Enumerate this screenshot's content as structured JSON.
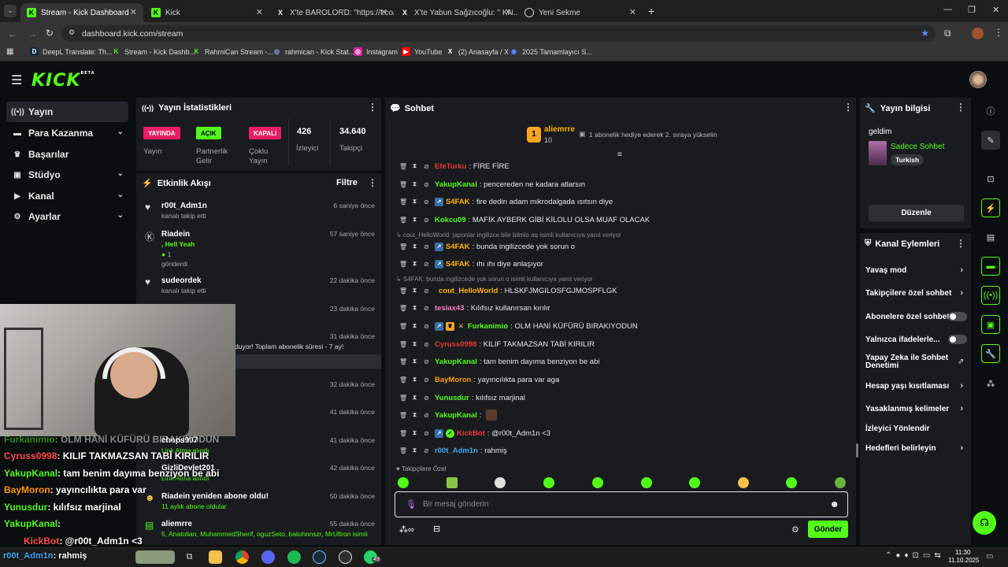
{
  "browser": {
    "tabs": [
      {
        "title": "Stream - Kick Dashboard",
        "active": true
      },
      {
        "title": "Kick",
        "active": false
      },
      {
        "title": "X'te BAROLORD: \"https://t.co/...",
        "active": false
      },
      {
        "title": "X'te Yabun Sağzıcoğlu: \" KN...",
        "active": false
      },
      {
        "title": "Yeni Sekme",
        "active": false
      }
    ],
    "url": "dashboard.kick.com/stream",
    "bookmarks": [
      "DeepL Translate: Th...",
      "Stream - Kick Dashb...",
      "RahmiCan Stream -...",
      "rahmican - Kick Stat...",
      "Instagram",
      "YouTube",
      "(2) Anasayfa / X",
      "2025 Tamamlayıcı S..."
    ]
  },
  "brand": {
    "logo": "KICK",
    "beta": "BETA",
    "accent": "#53fc18"
  },
  "sidebar": {
    "items": [
      {
        "label": "Yayın",
        "icon": "broadcast-icon",
        "active": true
      },
      {
        "label": "Para Kazanma",
        "icon": "money-icon"
      },
      {
        "label": "Başarılar",
        "icon": "trophy-icon"
      },
      {
        "label": "Stüdyo",
        "icon": "studio-icon"
      },
      {
        "label": "Kanal",
        "icon": "channel-icon"
      },
      {
        "label": "Ayarlar",
        "icon": "gear-icon"
      }
    ]
  },
  "stats": {
    "title": "Yayın İstatistikleri",
    "items": [
      {
        "badge": "YAYINDA",
        "label": "Yayın",
        "color": "#e91e63"
      },
      {
        "badge": "AÇIK",
        "label": "Partnerlik Gelir",
        "color": "#53fc18"
      },
      {
        "badge": "KAPALI",
        "label": "Çoklu Yayın",
        "color": "#e91e63"
      },
      {
        "value": "426",
        "label": "İzleyici"
      },
      {
        "value": "34.640",
        "label": "Takipçi"
      }
    ]
  },
  "activity": {
    "title": "Etkinlik Akışı",
    "filter": "Filtre",
    "items": [
      {
        "name": "r00t_Adm1n",
        "sub": "kanalı takip etti",
        "time": "6 saniye önce"
      },
      {
        "name": "Riadein",
        "sub": ", Hell Yeah",
        "extra": "1",
        "extra2": "gönderdi",
        "time": "57 saniye önce"
      },
      {
        "name": "sudeordek",
        "sub": "kanalı takip etti",
        "time": "22 dakika önce"
      },
      {
        "time": "23 dakika önce"
      },
      {
        "sub": "duyor! Toplam abonelik süresi - 7 ay!",
        "time": "31 dakika önce"
      },
      {
        "time": "32 dakika önce"
      },
      {
        "time": "41 dakika önce"
      },
      {
        "name": "chops907",
        "sub": "Link Atma alındı",
        "time": "41 dakika önce"
      },
      {
        "name": "GizliDevlet201",
        "sub": "Link Atma alındı",
        "time": "42 dakika önce"
      },
      {
        "name": "Riadein yeniden abone oldu!",
        "sub": "11 aylık abone oldular",
        "time": "50 dakika önce"
      },
      {
        "name": "aliemrre",
        "sub": "5, Anatolian, MuhammedSherif, oguzSeto, batuhnnszr, MrUltron isimli",
        "time": "55 dakika önce"
      }
    ]
  },
  "chat": {
    "title": "Sohbet",
    "pinned": {
      "user": "aliemrre",
      "count": "10",
      "rank": "1",
      "text": "1 abonelik hediye ederek 2. sıraya yükselin"
    },
    "messages": [
      {
        "user": "EfeTurku",
        "color": "#e53935",
        "text": ": FİRE FİRE"
      },
      {
        "user": "YakupKanal",
        "color": "#53fc18",
        "text": ": pencereden ne kadara atlarsın"
      },
      {
        "user": "S4FAK",
        "color": "#ffb300",
        "text": ": fire dedin adam mikrodalgada ısıtsın diye"
      },
      {
        "user": "Kokcu09",
        "color": "#53fc18",
        "text": ": MAFİK AYBERK GİBİ KİLOLU OLSA MUAF OLACAK"
      },
      {
        "reply": "cout_HelloWorld: japonlar ingilizce bile bilmio aq isimli kullanıcıya yanıt veriyor"
      },
      {
        "user": "S4FAK",
        "color": "#ffb300",
        "text": ": bunda ingilizcede yok sorun o"
      },
      {
        "user": "S4FAK",
        "color": "#ffb300",
        "text": ": ıhı ıhı diye anlaşıyor"
      },
      {
        "reply": "S4FAK: bunda ingilizcede yok sorun o isimli kullanıcıya yanıt veriyor"
      },
      {
        "user": "cout_HelloWorld",
        "color": "#ffb300",
        "text": ": HLSKFJMGILOSFGJMOSPFLGK"
      },
      {
        "user": "teslax43",
        "color": "#ff7ac4",
        "text": ": Kılıfsız kullanırsan kırılır"
      },
      {
        "user": "Furkanimio",
        "color": "#53fc18",
        "text": ": OLM HANİ KÜFÜRÜ BIRAKIYODUN"
      },
      {
        "user": "Cyruss0998",
        "color": "#e53935",
        "text": ": KILIF TAKMAZSAN TABİ KIRILIR"
      },
      {
        "user": "YakupKanal",
        "color": "#53fc18",
        "text": ": tam benim dayıma benziyon be abi"
      },
      {
        "user": "BayMoron",
        "color": "#ff9800",
        "text": ": yayıncılıkta para var aga"
      },
      {
        "user": "Yunusdur",
        "color": "#53fc18",
        "text": ": kılıfsız marjinal"
      },
      {
        "user": "YakupKanal",
        "color": "#53fc18",
        "text": ":"
      },
      {
        "user": "KickBot",
        "color": "#e53935",
        "text": ": @r00t_Adm1n <3"
      },
      {
        "user": "r00t_Adm1n",
        "color": "#3fa9f5",
        "text": ": rahmiş"
      }
    ],
    "followers_label": "Takipçilere Özel",
    "input_placeholder": "Bir mesaj gönderin",
    "send_label": "Gönder"
  },
  "stream_info": {
    "title": "Yayın bilgisi",
    "stream_title": "geldim",
    "category": "Sadece Sohbet",
    "tag": "Turkish",
    "edit_label": "Düzenle"
  },
  "channel_actions": {
    "title": "Kanal Eylemleri",
    "items": [
      {
        "label": "Yavaş mod",
        "type": "chevron"
      },
      {
        "label": "Takipçilere özel sohbet",
        "type": "chevron"
      },
      {
        "label": "Abonelere özel sohbet",
        "type": "toggle"
      },
      {
        "label": "Yalnızca ifadelerle...",
        "type": "toggle"
      },
      {
        "label": "Yapay Zeka ile Sohbet Denetimi",
        "type": "external"
      },
      {
        "label": "Hesap yaşı kısıtlaması",
        "type": "chevron"
      },
      {
        "label": "Yasaklanmış kelimeler",
        "type": "chevron"
      },
      {
        "label": "İzleyici Yönlendir",
        "type": "none"
      },
      {
        "label": "Hedefleri belirleyin",
        "type": "chevron"
      }
    ]
  },
  "overlay": {
    "lines": [
      {
        "user": "Furkanimio",
        "text": ": OLM HANİ KÜFÜRÜ BIRAKIYODUN",
        "color": "#53fc18"
      },
      {
        "user": "Cyruss0998",
        "text": ": KILIF TAKMAZSAN TABİ KIRILIR",
        "color": "#e53935"
      },
      {
        "user": "YakupKanal",
        "text": ": tam benim dayıma benziyon be abi",
        "color": "#53fc18"
      },
      {
        "user": "BayMoron",
        "text": ": yayıncılıkta para var",
        "color": "#ff9800"
      },
      {
        "user": "Yunusdur",
        "text": ": kılıfsız marjinal",
        "color": "#53fc18"
      },
      {
        "user": "YakupKanal",
        "text": ":",
        "color": "#53fc18"
      },
      {
        "user": "KickBot",
        "text": ": @r00t_Adm1n <3",
        "color": "#e53935"
      },
      {
        "user": "r00t_Adm1n",
        "text": ": rahmiş",
        "color": "#3fa9f5"
      }
    ]
  },
  "taskbar": {
    "time": "11:30",
    "date": "11.10.2025",
    "whatsapp_count": "49"
  }
}
